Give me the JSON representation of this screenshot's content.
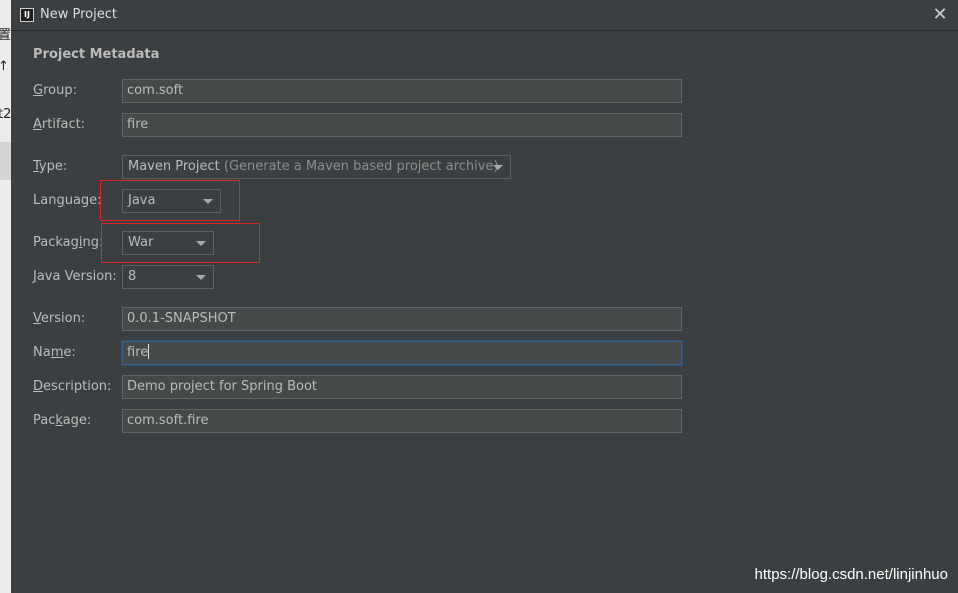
{
  "background": {
    "fragments": [
      "置",
      "↑",
      "t2"
    ]
  },
  "window": {
    "title": "New Project",
    "icon_text": "IJ",
    "close_glyph": "✕"
  },
  "section": {
    "title": "Project Metadata"
  },
  "fields": {
    "group": {
      "label_mnemonic": "G",
      "label_rest": "roup:",
      "value": "com.soft"
    },
    "artifact": {
      "label_mnemonic": "A",
      "label_rest": "rtifact:",
      "value": "fire"
    },
    "type": {
      "label_mnemonic": "T",
      "label_rest": "ype:",
      "value": "Maven Project",
      "hint": "(Generate a Maven based project archive)"
    },
    "language": {
      "label_pre": "Lan",
      "label_mnemonic": "g",
      "label_rest": "uage:",
      "value": "Java"
    },
    "packaging": {
      "label_pre": "Packag",
      "label_mnemonic": "i",
      "label_rest": "ng:",
      "value": "War"
    },
    "java_version": {
      "label_mnemonic": "J",
      "label_rest": "ava Version:",
      "value": "8"
    },
    "version": {
      "label_mnemonic": "V",
      "label_rest": "ersion:",
      "value": "0.0.1-SNAPSHOT"
    },
    "name": {
      "label_pre": "Na",
      "label_mnemonic": "m",
      "label_rest": "e:",
      "value": "fire"
    },
    "description": {
      "label_mnemonic": "D",
      "label_rest": "escription:",
      "value": "Demo project for Spring Boot"
    },
    "package": {
      "label_pre": "Pac",
      "label_mnemonic": "k",
      "label_rest": "age:",
      "value": "com.soft.fire"
    }
  },
  "watermark": "https://blog.csdn.net/linjinhuo",
  "colors": {
    "annotation": "#d92727",
    "focus": "#3d6185",
    "background": "#3c3f41"
  }
}
